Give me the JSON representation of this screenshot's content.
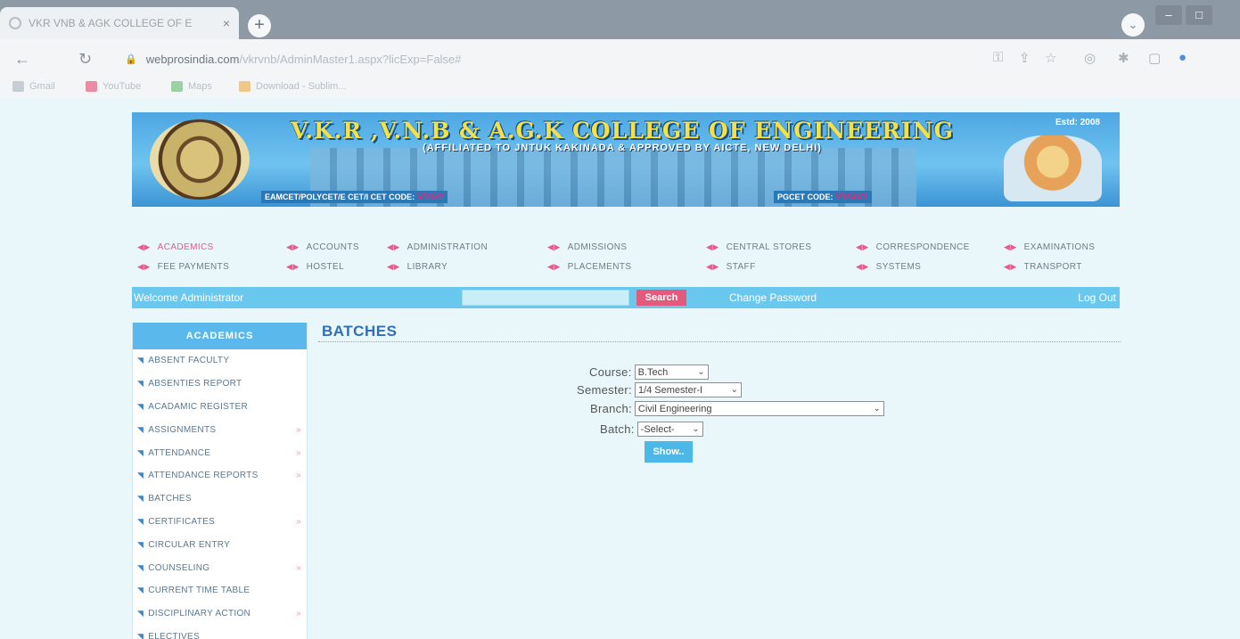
{
  "browser": {
    "tab_title": "VKR VNB & AGK COLLEGE OF E",
    "tab_close": "×",
    "new_tab": "+",
    "profile": "⌄",
    "win_min": "–",
    "win_max": "□",
    "url_host": "webprosindia.com",
    "url_path": "/vkrvnb/AdminMaster1.aspx?licExp=False#",
    "bookmarks": [
      "Gmail",
      "YouTube",
      "Maps",
      "Download - Sublim..."
    ]
  },
  "banner": {
    "college_name": "V.K.R ,V.N.B & A.G.K COLLEGE OF ENGINEERING",
    "affiliation": "(AFFILIATED TO JNTUK KAKINADA & APPROVED BY AICTE, NEW DELHI)",
    "estd": "Estd: 2008",
    "eamcet_code_label": "EAMCET/POLYCET/E CET/I CET CODE:",
    "eamcet_code": "VVGV",
    "pgcet_code_label": "PGCET CODE:",
    "pgcet_code": "VVGV1"
  },
  "menu": {
    "row1": [
      "ACADEMICS",
      "ACCOUNTS",
      "ADMINISTRATION",
      "ADMISSIONS",
      "CENTRAL STORES",
      "CORRESPONDENCE",
      "EXAMINATIONS"
    ],
    "row2": [
      "FEE PAYMENTS",
      "HOSTEL",
      "LIBRARY",
      "PLACEMENTS",
      "STAFF",
      "SYSTEMS",
      "TRANSPORT"
    ]
  },
  "toolbar": {
    "welcome": "Welcome Administrator",
    "search_value": "",
    "search_button": "Search",
    "change_password": "Change Password",
    "logout": "Log Out"
  },
  "sidebar": {
    "heading": "ACADEMICS",
    "items": [
      {
        "label": "ABSENT FACULTY",
        "more": ""
      },
      {
        "label": "ABSENTIES REPORT",
        "more": ""
      },
      {
        "label": "ACADAMIC REGISTER",
        "more": ""
      },
      {
        "label": "ASSIGNMENTS",
        "more": "»"
      },
      {
        "label": "ATTENDANCE",
        "more": "»"
      },
      {
        "label": "ATTENDANCE REPORTS",
        "more": "»"
      },
      {
        "label": "BATCHES",
        "more": ""
      },
      {
        "label": "CERTIFICATES",
        "more": "»"
      },
      {
        "label": "CIRCULAR ENTRY",
        "more": ""
      },
      {
        "label": "COUNSELING",
        "more": "»"
      },
      {
        "label": "CURRENT TIME TABLE",
        "more": ""
      },
      {
        "label": "DISCIPLINARY ACTION",
        "more": "»"
      },
      {
        "label": "ELECTIVES",
        "more": ""
      }
    ]
  },
  "main": {
    "title": "BATCHES",
    "form": {
      "course_label": "Course:",
      "course_value": "B.Tech",
      "semester_label": "Semester:",
      "semester_value": "1/4 Semester-I",
      "branch_label": "Branch:",
      "branch_value": "Civil Engineering",
      "batch_label": "Batch:",
      "batch_value": "-Select-",
      "show_button": "Show.."
    }
  }
}
